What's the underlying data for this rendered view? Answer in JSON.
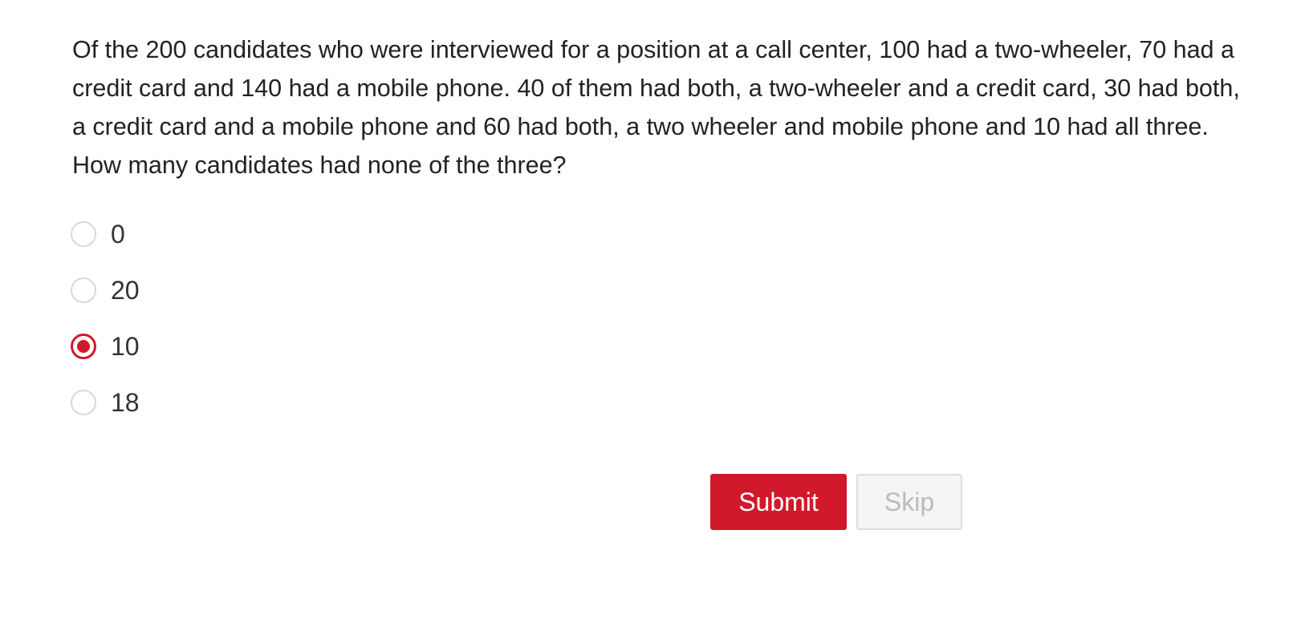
{
  "question": {
    "text": "Of the 200 candidates who were interviewed for a position at a call center, 100 had a two-wheeler, 70 had a credit card and 140 had a mobile phone. 40 of them had both, a two-wheeler and a credit card, 30 had both, a credit card and a mobile phone and 60 had both, a two wheeler and mobile phone and 10 had all three. How many candidates had none of the three?"
  },
  "options": [
    {
      "label": "0",
      "selected": false
    },
    {
      "label": "20",
      "selected": false
    },
    {
      "label": "10",
      "selected": true
    },
    {
      "label": "18",
      "selected": false
    }
  ],
  "actions": {
    "submit_label": "Submit",
    "skip_label": "Skip"
  },
  "colors": {
    "accent": "#d0192a",
    "text": "#222222",
    "disabled_text": "#bbbbbb"
  }
}
